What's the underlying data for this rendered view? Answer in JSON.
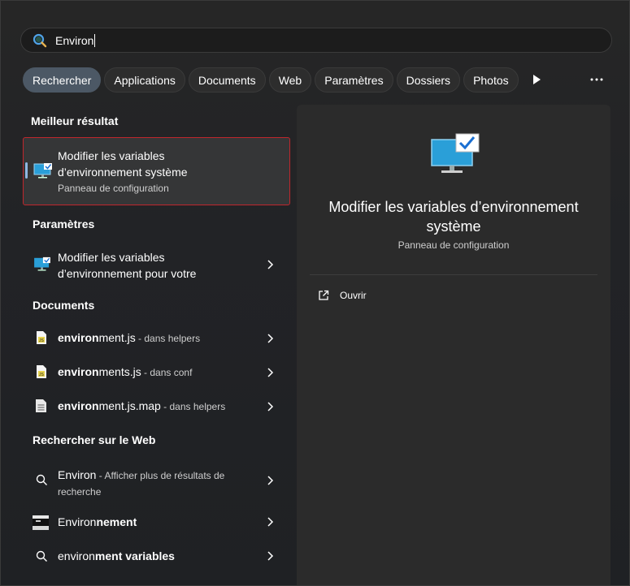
{
  "search": {
    "value": "Environ",
    "icon": "search-icon"
  },
  "filters": [
    {
      "label": "Rechercher",
      "active": true
    },
    {
      "label": "Applications"
    },
    {
      "label": "Documents"
    },
    {
      "label": "Web"
    },
    {
      "label": "Paramètres"
    },
    {
      "label": "Dossiers"
    },
    {
      "label": "Photos"
    }
  ],
  "sections": {
    "best": "Meilleur résultat",
    "settings": "Paramètres",
    "documents": "Documents",
    "web": "Rechercher sur le Web"
  },
  "best_result": {
    "title_line1": "Modifier les variables",
    "title_line2": "d’environnement système",
    "subtitle": "Panneau de configuration"
  },
  "settings_result": {
    "title_line1": "Modifier les variables",
    "title_line2": "d’environnement pour votre"
  },
  "documents": [
    {
      "bold": "environ",
      "rest": "ment.js",
      "loc": " - dans helpers"
    },
    {
      "bold": "environ",
      "rest": "ments.js",
      "loc": " - dans conf"
    },
    {
      "bold": "environ",
      "rest": "ment.js.map",
      "loc": " - dans helpers"
    }
  ],
  "web": {
    "item1_query": "Environ",
    "item1_rest_line1": " - Afficher plus de résultats de",
    "item1_rest_line2": "recherche",
    "item2_plain": "Environ",
    "item2_bold": "nement",
    "item3_plain": "environ",
    "item3_bold": "ment variables"
  },
  "preview": {
    "title_line1": "Modifier les variables d’environnement",
    "title_line2": "système",
    "subtitle": "Panneau de configuration",
    "open_label": "Ouvrir"
  },
  "colors": {
    "accent": "#4c5865",
    "highlight_border": "#c0272d"
  }
}
